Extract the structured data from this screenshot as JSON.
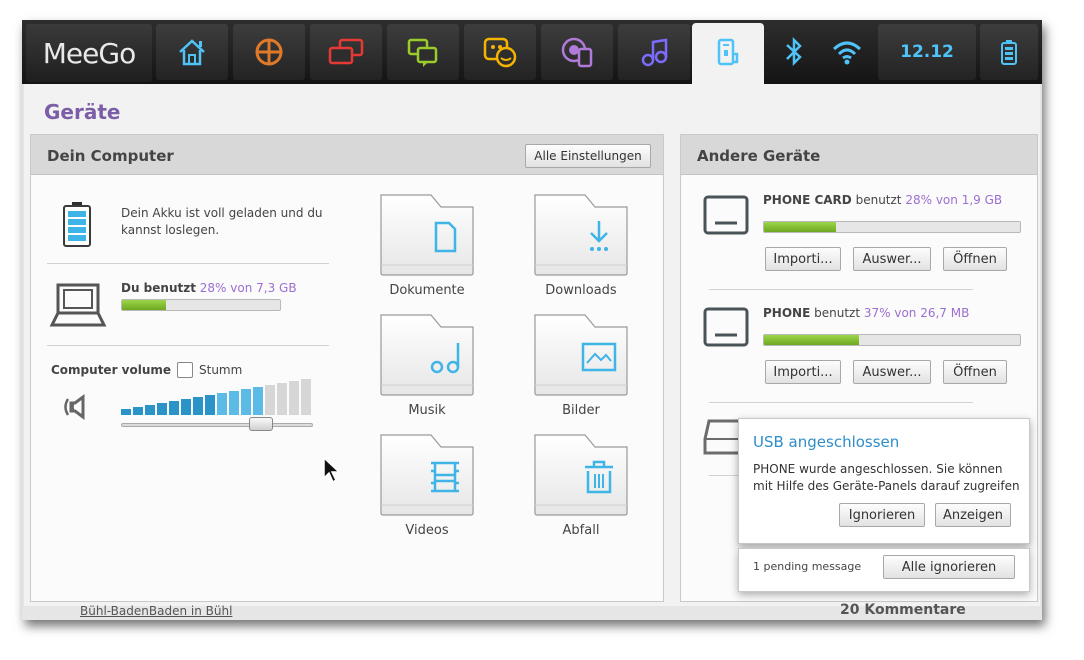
{
  "topbar": {
    "logo": "MeeGo",
    "zones": [
      {
        "icon": "home-icon",
        "color": "#4fc3f7"
      },
      {
        "icon": "applications-icon",
        "color": "#e07a2a"
      },
      {
        "icon": "windows-icon",
        "color": "#e53935"
      },
      {
        "icon": "chat-icon",
        "color": "#9ccc2a"
      },
      {
        "icon": "people-icon",
        "color": "#f5b400"
      },
      {
        "icon": "web-icon",
        "color": "#b07ad9"
      },
      {
        "icon": "music-icon",
        "color": "#7b6cff"
      },
      {
        "icon": "devices-icon",
        "color": "#4fc3f7",
        "active": true
      },
      {
        "icon": "bluetooth-icon",
        "color": "#4fc3f7"
      },
      {
        "icon": "wifi-icon",
        "color": "#4fc3f7"
      }
    ],
    "clock": "12.12",
    "battery_icon": "battery-icon"
  },
  "panel": {
    "title": "Geräte"
  },
  "computer": {
    "heading": "Dein Computer",
    "settings_button": "Alle Einstellungen",
    "battery_text": "Dein Akku ist voll geladen und du kannst loslegen.",
    "usage_label": "Du benutzt",
    "usage_value": "28% von 7,3 GB",
    "usage_fraction": 0.28,
    "volume_label": "Computer volume",
    "mute_label": "Stumm",
    "volume_level": 0.73,
    "folders": [
      {
        "label": "Dokumente",
        "icon": "document-icon"
      },
      {
        "label": "Downloads",
        "icon": "download-icon"
      },
      {
        "label": "Musik",
        "icon": "music-note-icon"
      },
      {
        "label": "Bilder",
        "icon": "picture-icon"
      },
      {
        "label": "Videos",
        "icon": "film-icon"
      },
      {
        "label": "Abfall",
        "icon": "trash-icon"
      }
    ]
  },
  "other": {
    "heading": "Andere Geräte",
    "devices": [
      {
        "name": "PHONE CARD",
        "used_word": "benutzt",
        "usage": "28% von 1,9 GB",
        "fraction": 0.28,
        "buttons": [
          "Importi...",
          "Auswer...",
          "Öffnen"
        ]
      },
      {
        "name": "PHONE",
        "used_word": "benutzt",
        "usage": "37% von 26,7 MB",
        "fraction": 0.37,
        "buttons": [
          "Importi...",
          "Auswer...",
          "Öffnen"
        ]
      }
    ]
  },
  "notification": {
    "title": "USB angeschlossen",
    "body": "PHONE wurde angeschlossen. Sie können mit Hilfe des Geräte-Panels darauf zugreifen",
    "ignore_button": "Ignorieren",
    "show_button": "Anzeigen",
    "pending": "1 pending message",
    "ignore_all_button": "Alle ignorieren"
  },
  "background_page": {
    "left_link": "Bühl-BadenBaden in Bühl",
    "comments": "20 Kommentare"
  }
}
